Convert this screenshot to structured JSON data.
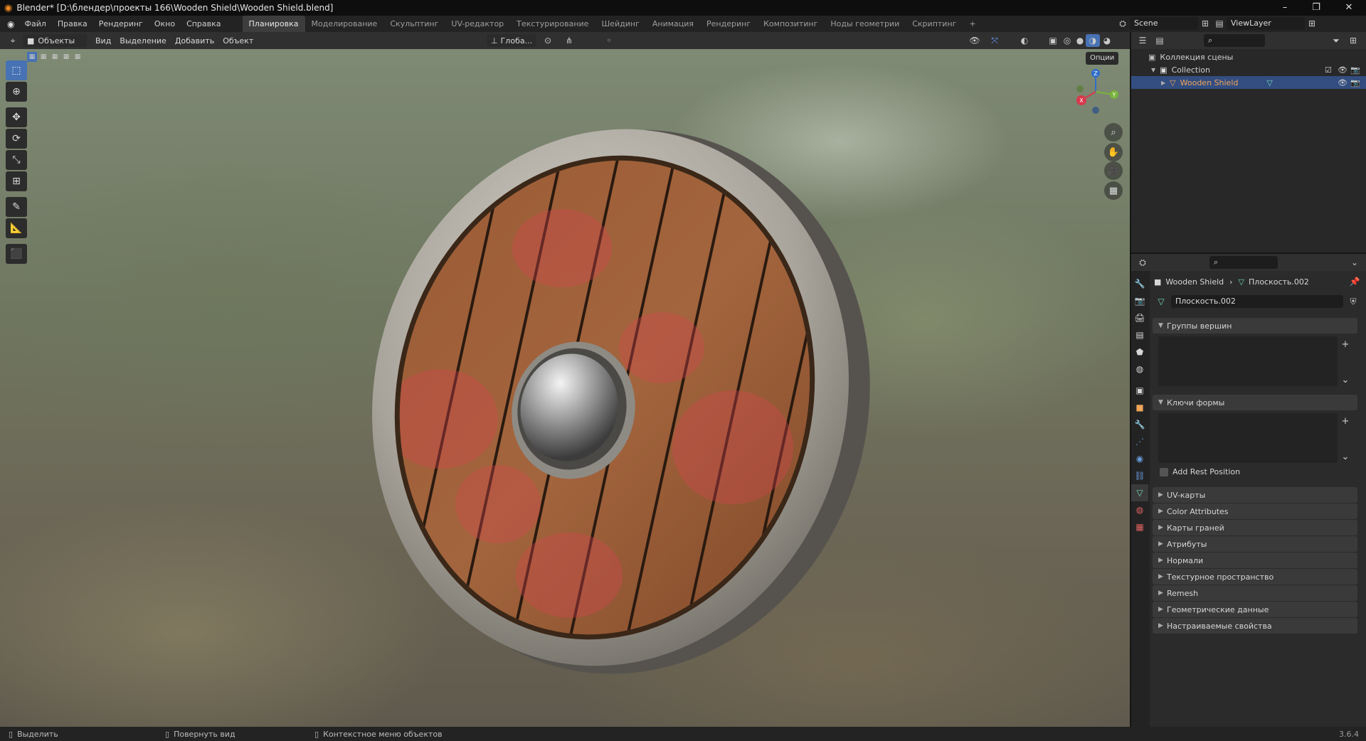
{
  "window": {
    "title": "Blender* [D:\\блендер\\проекты 166\\Wooden Shield\\Wooden Shield.blend]",
    "minimize": "–",
    "maximize": "❐",
    "close": "✕"
  },
  "menu": [
    "Файл",
    "Правка",
    "Рендеринг",
    "Окно",
    "Справка"
  ],
  "workspaces": [
    "Планировка",
    "Моделирование",
    "Скульптинг",
    "UV-редактор",
    "Текстурирование",
    "Шейдинг",
    "Анимация",
    "Рендеринг",
    "Композитинг",
    "Ноды геометрии",
    "Скриптинг"
  ],
  "workspace_add": "+",
  "scene": {
    "name": "Scene",
    "view_layer": "ViewLayer"
  },
  "viewport_header": {
    "mode": "Объекты",
    "menus": [
      "Вид",
      "Выделение",
      "Добавить",
      "Объект"
    ],
    "orientation": "Глоба...",
    "options": "Опции"
  },
  "gizmo": {
    "x": "X",
    "y": "Y",
    "z": "Z"
  },
  "outliner": {
    "scene_collection": "Коллекция сцены",
    "collection": "Collection",
    "object": "Wooden Shield"
  },
  "properties": {
    "breadcrumb_object": "Wooden Shield",
    "breadcrumb_mesh": "Плоскость.002",
    "mesh_name": "Плоскость.002",
    "panels": {
      "vertex_groups": "Группы вершин",
      "shape_keys": "Ключи формы",
      "add_rest_position": "Add Rest Position",
      "collapsed": [
        "UV-карты",
        "Color Attributes",
        "Карты граней",
        "Атрибуты",
        "Нормали",
        "Текстурное пространство",
        "Remesh",
        "Геометрические данные",
        "Настраиваемые свойства"
      ]
    }
  },
  "statusbar": {
    "select": "Выделить",
    "rotate": "Повернуть вид",
    "context": "Контекстное меню объектов",
    "version": "3.6.4"
  },
  "colors": {
    "accent": "#4772b3",
    "selected_row": "#334d80",
    "object_name": "#f0a55a"
  }
}
